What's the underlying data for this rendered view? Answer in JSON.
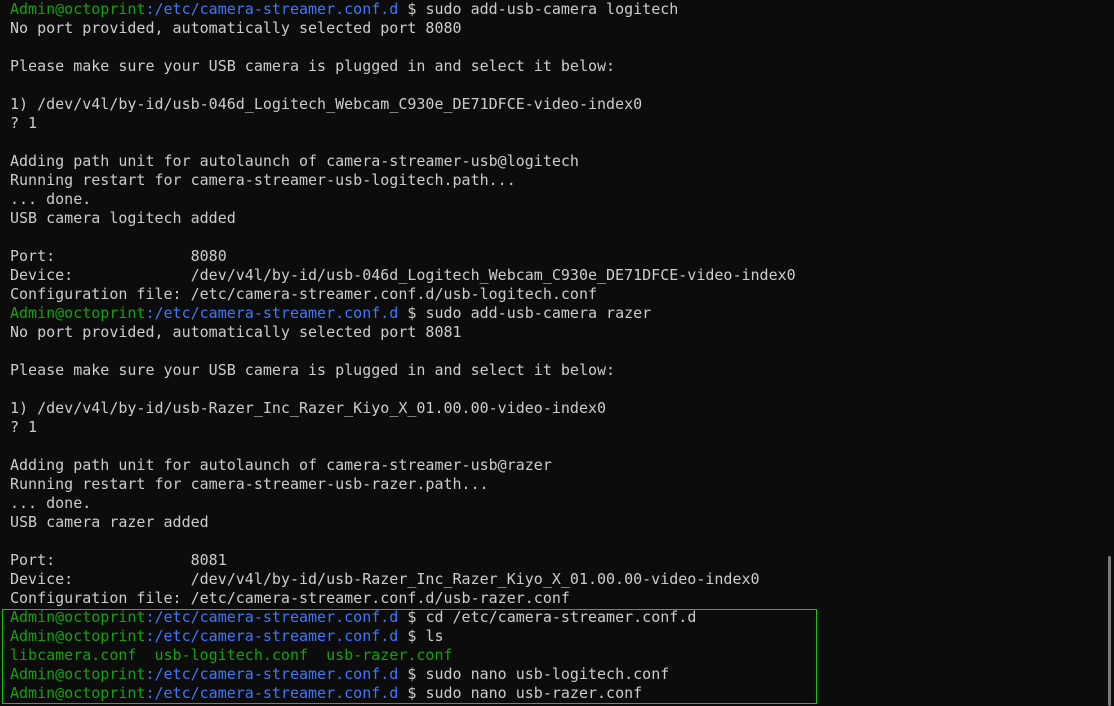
{
  "prompt": {
    "user": "Admin@octoprint",
    "path": ":/etc/camera-streamer.conf.d",
    "symbol": " $ "
  },
  "lines": [
    {
      "type": "prompt",
      "cmd": "sudo add-usb-camera logitech"
    },
    {
      "type": "text",
      "text": "No port provided, automatically selected port 8080"
    },
    {
      "type": "text",
      "text": ""
    },
    {
      "type": "text",
      "text": "Please make sure your USB camera is plugged in and select it below:"
    },
    {
      "type": "text",
      "text": ""
    },
    {
      "type": "text",
      "text": "1) /dev/v4l/by-id/usb-046d_Logitech_Webcam_C930e_DE71DFCE-video-index0"
    },
    {
      "type": "text",
      "text": "? 1"
    },
    {
      "type": "text",
      "text": ""
    },
    {
      "type": "text",
      "text": "Adding path unit for autolaunch of camera-streamer-usb@logitech"
    },
    {
      "type": "text",
      "text": "Running restart for camera-streamer-usb-logitech.path..."
    },
    {
      "type": "text",
      "text": "... done."
    },
    {
      "type": "text",
      "text": "USB camera logitech added"
    },
    {
      "type": "text",
      "text": ""
    },
    {
      "type": "text",
      "text": "Port:               8080"
    },
    {
      "type": "text",
      "text": "Device:             /dev/v4l/by-id/usb-046d_Logitech_Webcam_C930e_DE71DFCE-video-index0"
    },
    {
      "type": "text",
      "text": "Configuration file: /etc/camera-streamer.conf.d/usb-logitech.conf"
    },
    {
      "type": "prompt",
      "cmd": "sudo add-usb-camera razer"
    },
    {
      "type": "text",
      "text": "No port provided, automatically selected port 8081"
    },
    {
      "type": "text",
      "text": ""
    },
    {
      "type": "text",
      "text": "Please make sure your USB camera is plugged in and select it below:"
    },
    {
      "type": "text",
      "text": ""
    },
    {
      "type": "text",
      "text": "1) /dev/v4l/by-id/usb-Razer_Inc_Razer_Kiyo_X_01.00.00-video-index0"
    },
    {
      "type": "text",
      "text": "? 1"
    },
    {
      "type": "text",
      "text": ""
    },
    {
      "type": "text",
      "text": "Adding path unit for autolaunch of camera-streamer-usb@razer"
    },
    {
      "type": "text",
      "text": "Running restart for camera-streamer-usb-razer.path..."
    },
    {
      "type": "text",
      "text": "... done."
    },
    {
      "type": "text",
      "text": "USB camera razer added"
    },
    {
      "type": "text",
      "text": ""
    },
    {
      "type": "text",
      "text": "Port:               8081"
    },
    {
      "type": "text",
      "text": "Device:             /dev/v4l/by-id/usb-Razer_Inc_Razer_Kiyo_X_01.00.00-video-index0"
    },
    {
      "type": "text",
      "text": "Configuration file: /etc/camera-streamer.conf.d/usb-razer.conf"
    },
    {
      "type": "prompt",
      "cmd": "cd /etc/camera-streamer.conf.d"
    },
    {
      "type": "prompt",
      "cmd": "ls"
    },
    {
      "type": "files",
      "files": [
        "libcamera.conf",
        "usb-logitech.conf",
        "usb-razer.conf"
      ]
    },
    {
      "type": "prompt",
      "cmd": "sudo nano usb-logitech.conf"
    },
    {
      "type": "prompt",
      "cmd": "sudo nano usb-razer.conf"
    }
  ],
  "colors": {
    "background": "#0c0c0c",
    "user": "#13a10e",
    "path": "#3b78ff",
    "text": "#cccccc",
    "highlight": "#16c60c"
  }
}
